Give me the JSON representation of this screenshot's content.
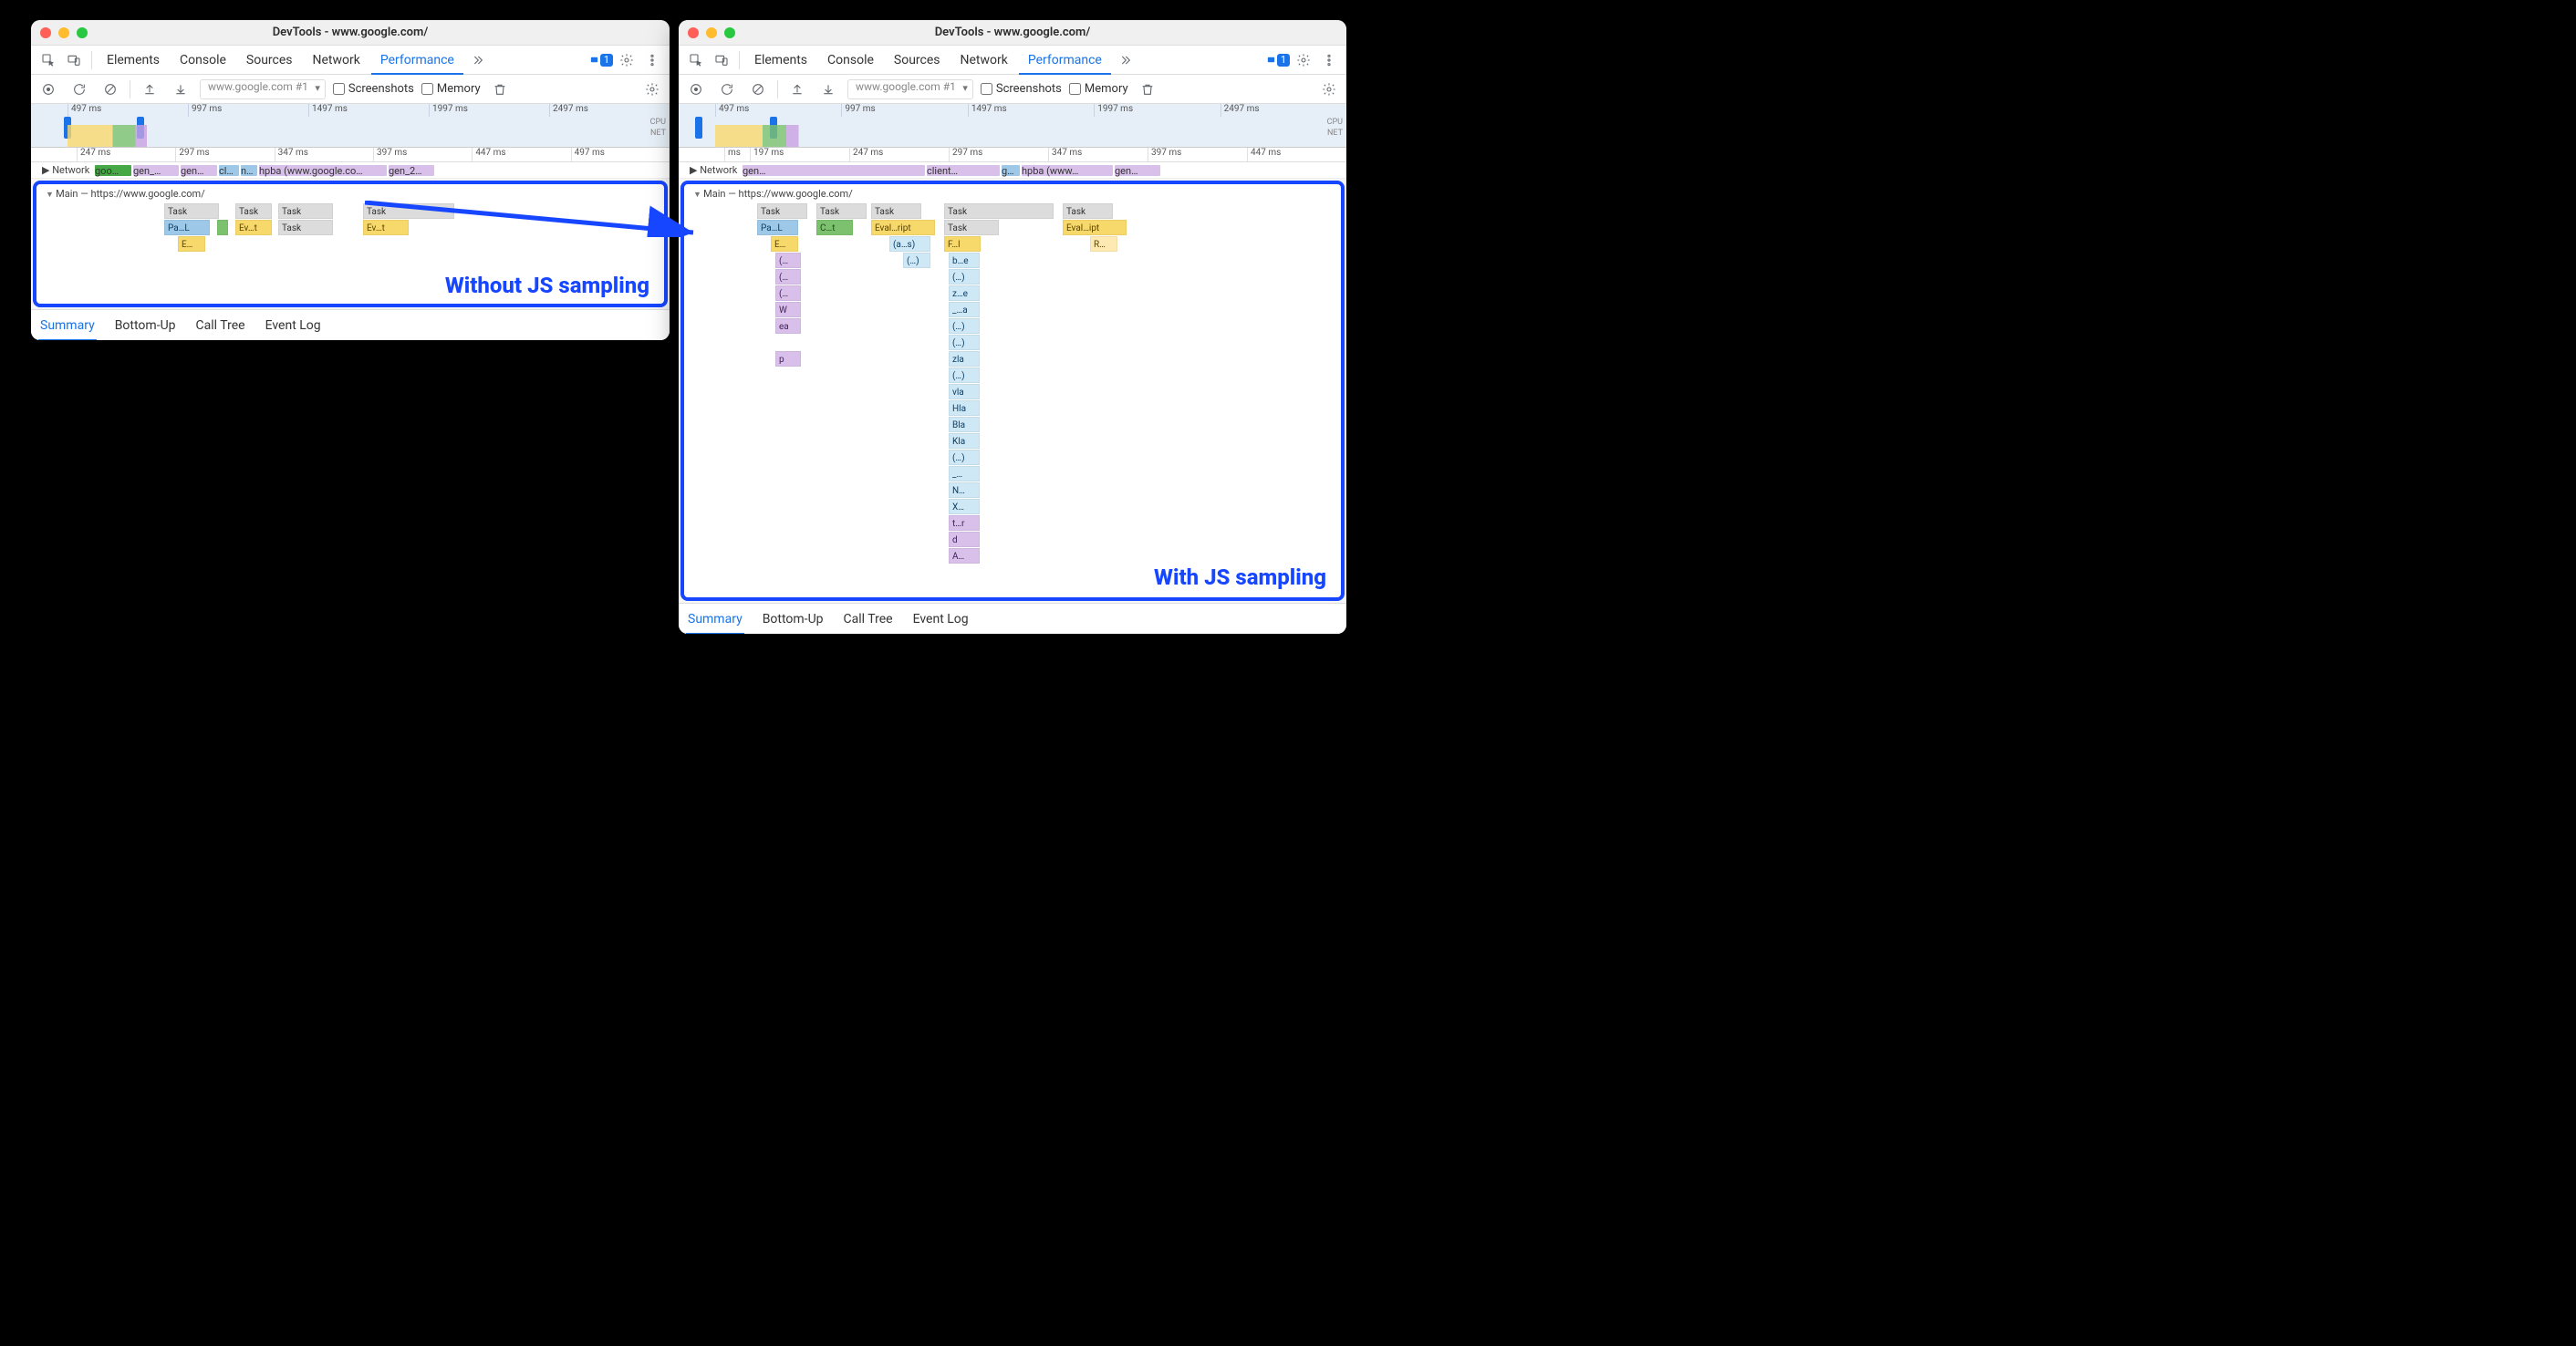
{
  "window_title": "DevTools - www.google.com/",
  "tabs": [
    "Elements",
    "Console",
    "Sources",
    "Network",
    "Performance"
  ],
  "active_tab": "Performance",
  "issues_count": "1",
  "recording_label": "www.google.com #1",
  "chk_screenshots": "Screenshots",
  "chk_memory": "Memory",
  "overview_ticks": [
    "497 ms",
    "997 ms",
    "1497 ms",
    "1997 ms",
    "2497 ms"
  ],
  "ov_side": {
    "cpu": "CPU",
    "net": "NET"
  },
  "ruler_left": [
    "247 ms",
    "297 ms",
    "347 ms",
    "397 ms",
    "447 ms",
    "497 ms"
  ],
  "ruler_right": [
    "197 ms",
    "247 ms",
    "297 ms",
    "347 ms",
    "397 ms",
    "447 ms"
  ],
  "ruler_right_prefix": "ms",
  "netrow_label": "Network",
  "net_left": [
    "goo…",
    "gen_…",
    "gen…",
    "cl…",
    "n…",
    "hpba (www.google.co…",
    "gen_2…"
  ],
  "net_right": [
    "gen…",
    "client…",
    "g…",
    "hpba (www…",
    "gen…"
  ],
  "main_label": "Main — https://www.google.com/",
  "caption_left": "Without JS sampling",
  "caption_right": "With JS sampling",
  "bottom_tabs": [
    "Summary",
    "Bottom-Up",
    "Call Tree",
    "Event Log"
  ],
  "flame_left": {
    "rows": [
      [
        {
          "l": 140,
          "w": 60,
          "c": "gray",
          "t": "Task"
        },
        {
          "l": 218,
          "w": 40,
          "c": "gray",
          "t": "Task"
        },
        {
          "l": 265,
          "w": 60,
          "c": "gray",
          "t": "Task"
        },
        {
          "l": 358,
          "w": 100,
          "c": "gray",
          "t": "Task"
        }
      ],
      [
        {
          "l": 140,
          "w": 50,
          "c": "blue",
          "t": "Pa…L"
        },
        {
          "l": 198,
          "w": 12,
          "c": "green",
          "t": ""
        },
        {
          "l": 218,
          "w": 40,
          "c": "yellow",
          "t": "Ev…t"
        },
        {
          "l": 265,
          "w": 60,
          "c": "gray",
          "t": "Task"
        },
        {
          "l": 358,
          "w": 50,
          "c": "yellow",
          "t": "Ev…t"
        }
      ],
      [
        {
          "l": 155,
          "w": 30,
          "c": "yellow",
          "t": "E…"
        }
      ]
    ]
  },
  "flame_right": {
    "tasks": [
      "Task",
      "Task",
      "Task",
      "Task",
      "Task"
    ],
    "col1": [
      "Pa…L",
      "E…",
      "(…",
      "(…",
      "(…",
      "W",
      "ea",
      "",
      "p"
    ],
    "col1_colors": [
      "blue",
      "yellow",
      "purple",
      "purple",
      "purple",
      "purple",
      "purple",
      "",
      "purple"
    ],
    "col2": "C…t",
    "col3_top": "Eval…ript",
    "col3": [
      "(a…s)",
      "(…)"
    ],
    "col4_top": "Task",
    "col4": [
      "F…l",
      "b…e",
      "(…)",
      "z…e",
      "_…a",
      "(…)",
      "(…)",
      "zla",
      "(…)",
      "vla",
      "Hla",
      "Bla",
      "Kla",
      "(…)",
      "_…",
      "N…",
      "X…",
      "t…r",
      "d",
      "A…"
    ],
    "col4_colors": [
      "yellow",
      "lblue",
      "lblue",
      "lblue",
      "lblue",
      "lblue",
      "lblue",
      "lblue",
      "lblue",
      "lblue",
      "lblue",
      "lblue",
      "lblue",
      "lblue",
      "lblue",
      "lblue",
      "lblue",
      "purple",
      "purple",
      "purple"
    ],
    "col5_top": "Task",
    "col5": [
      "Eval…ipt",
      "R…"
    ]
  }
}
